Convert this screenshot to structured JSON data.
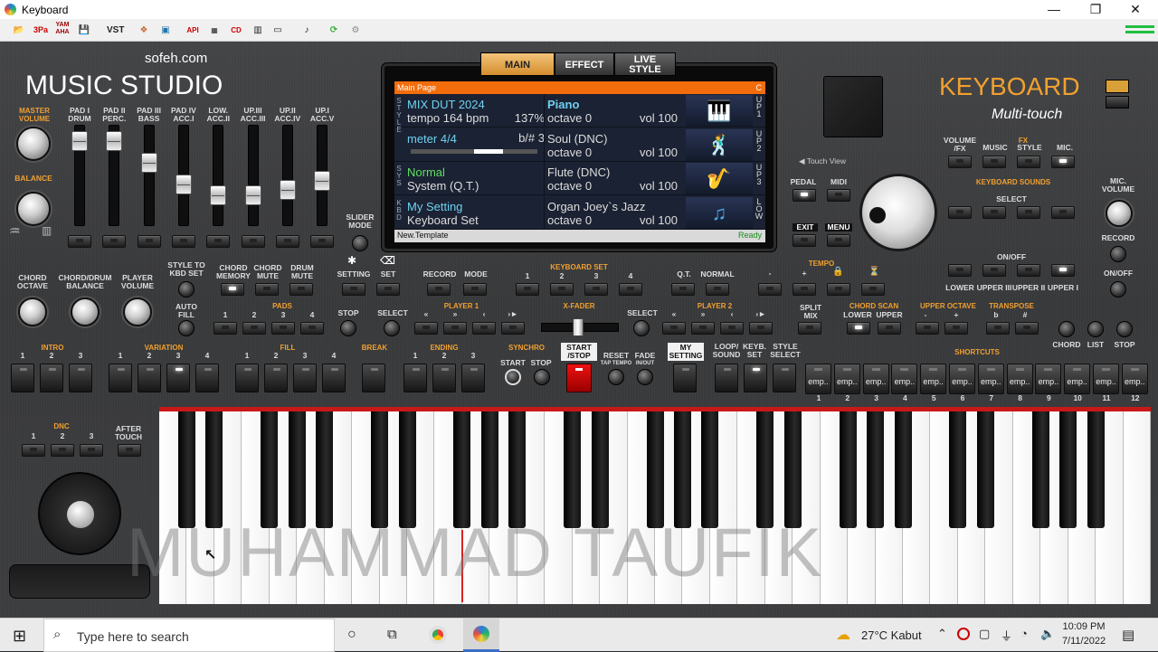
{
  "window": {
    "title": "Keyboard",
    "minimize": "—",
    "restore": "❐",
    "close": "✕"
  },
  "toolbar": {
    "items": [
      "open-icon",
      "3pa",
      "YAM AHA",
      "save",
      "VST",
      "mixer-icon",
      "window-icon",
      "API",
      "MIDI",
      "CD",
      "layout-icon",
      "window2-icon",
      "music-note-icon",
      "refresh-icon",
      "settings-icon"
    ]
  },
  "brand": {
    "site": "sofeh.com",
    "name": "MUSIC STUDIO",
    "product": "KEYBOARD",
    "sub": "Multi-touch"
  },
  "top_labels": {
    "master": "MASTER\nVOLUME",
    "balance": "BALANCE",
    "sliders": [
      "PAD I\nDRUM",
      "PAD II\nPERC.",
      "PAD III\nBASS",
      "PAD IV\nACC.I",
      "LOW.\nACC.II",
      "UP.III\nACC.III",
      "UP.II\nACC.IV",
      "UP.I\nACC.V"
    ],
    "slider_mode": "SLIDER\nMODE",
    "chord_octave": "CHORD\nOCTAVE",
    "chord_drum_balance": "CHORD/DRUM\nBALANCE",
    "player_volume": "PLAYER\nVOLUME",
    "style_to_kbd": "STYLE TO\nKBD SET",
    "auto_fill": "AUTO\nFILL",
    "chord_memory": "CHORD\nMEMORY",
    "chord_mute": "CHORD\nMUTE",
    "drum_mute": "DRUM\nMUTE",
    "setting": "SETTING",
    "set": "SET",
    "record": "RECORD",
    "mode": "MODE",
    "keyboard_set": "KEYBOARD SET",
    "qt": "Q.T.",
    "normal": "NORMAL",
    "tempo": "TEMPO",
    "touch_view": "Touch View",
    "pedal": "PEDAL",
    "midi": "MIDI",
    "exit": "EXIT",
    "menu": "MENU",
    "volume_fx": "VOLUME\n/FX",
    "fx": "FX",
    "music": "MUSIC",
    "style": "STYLE",
    "mic": "MIC.",
    "keyboard_sounds": "KEYBOARD SOUNDS",
    "select": "SELECT",
    "onoff": "ON/OFF",
    "lower_labels": [
      "LOWER",
      "UPPER III",
      "UPPER II",
      "UPPER I"
    ],
    "mic_volume": "MIC.\nVOLUME",
    "record2": "RECORD",
    "onoff2": "ON/OFF"
  },
  "screen": {
    "tabs": [
      "MAIN",
      "EFFECT",
      "LIVE\nSTYLE"
    ],
    "header": "Main Page",
    "header_right": "C",
    "side_left": [
      "S T Y L E",
      "S Y S",
      "K B D"
    ],
    "rows": [
      {
        "l1": "MIX DUT 2024",
        "l2": "tempo 164 bpm",
        "l3": "137%",
        "r1": "Piano",
        "r2": "octave 0",
        "r3": "vol 100",
        "tag": "UP1"
      },
      {
        "l1": "meter 4/4",
        "l2": "",
        "l3": "b/# 3",
        "r1": "Soul (DNC)",
        "r2": "octave 0",
        "r3": "vol 100",
        "tag": "UP2"
      },
      {
        "l1": "Normal",
        "l2": "System (Q.T.)",
        "l3": "",
        "r1": "Flute (DNC)",
        "r2": "octave 0",
        "r3": "vol 100",
        "tag": "UP3"
      },
      {
        "l1": "My Setting",
        "l2": "Keyboard Set",
        "l3": "",
        "r1": "Organ Joey`s Jazz",
        "r2": "octave 0",
        "r3": "vol 100",
        "tag": "LOW"
      }
    ],
    "footer_left": "New.Template",
    "footer_right": "Ready"
  },
  "mid_labels": {
    "pads": "PADS",
    "pad_nums": [
      "1",
      "2",
      "3",
      "4"
    ],
    "stop": "STOP",
    "player1": "PLAYER 1",
    "player2": "PLAYER 2",
    "select": "SELECT",
    "xfader": "X-FADER",
    "split_mix": "SPLIT\nMIX",
    "chord_scan": "CHORD SCAN",
    "upper_octave": "UPPER OCTAVE",
    "transpose": "TRANSPOSE",
    "lower": "LOWER",
    "upper": "UPPER",
    "minus": "-",
    "plus": "+",
    "flat": "b",
    "sharp": "#",
    "chord": "CHORD",
    "list": "LIST",
    "stop2": "STOP",
    "transport": [
      "«",
      "»",
      "‹",
      "›►"
    ]
  },
  "bottom_labels": {
    "intro": "INTRO",
    "variation": "VARIATION",
    "fill": "FILL",
    "break": "BREAK",
    "ending": "ENDING",
    "synchro": "SYNCHRO",
    "start": "START",
    "stop": "STOP",
    "start_stop": "START\n/STOP",
    "reset": "RESET",
    "tap_tempo": "TAP TEMPO",
    "fade": "FADE",
    "in_out": "IN/OUT",
    "my_setting": "MY\nSETTING",
    "loop_sound": "LOOP/\nSOUND",
    "keyb_set": "KEYB.\nSET",
    "style_select": "STYLE\nSELECT",
    "shortcuts": "SHORTCUTS",
    "dnc": "DNC",
    "after_touch": "AFTER\nTOUCH",
    "nums3": [
      "1",
      "2",
      "3"
    ],
    "nums4": [
      "1",
      "2",
      "3",
      "4"
    ],
    "shortcut_tiles": [
      "emp..",
      "emp..",
      "emp..",
      "emp..",
      "emp..",
      "emp..",
      "emp..",
      "emp..",
      "emp..",
      "emp..",
      "emp..",
      "emp.."
    ],
    "shortcut_nums": [
      "1",
      "2",
      "3",
      "4",
      "5",
      "6",
      "7",
      "8",
      "9",
      "10",
      "11",
      "12"
    ]
  },
  "watermark": "MUHAMMAD TAUFIK",
  "taskbar": {
    "search_placeholder": "Type here to search",
    "weather": "27°C  Kabut",
    "time": "10:09 PM",
    "date": "7/11/2022"
  },
  "colors": {
    "accent": "#f0a030",
    "screen_header": "#f36d0c",
    "active_tab": "#e8a64a"
  }
}
